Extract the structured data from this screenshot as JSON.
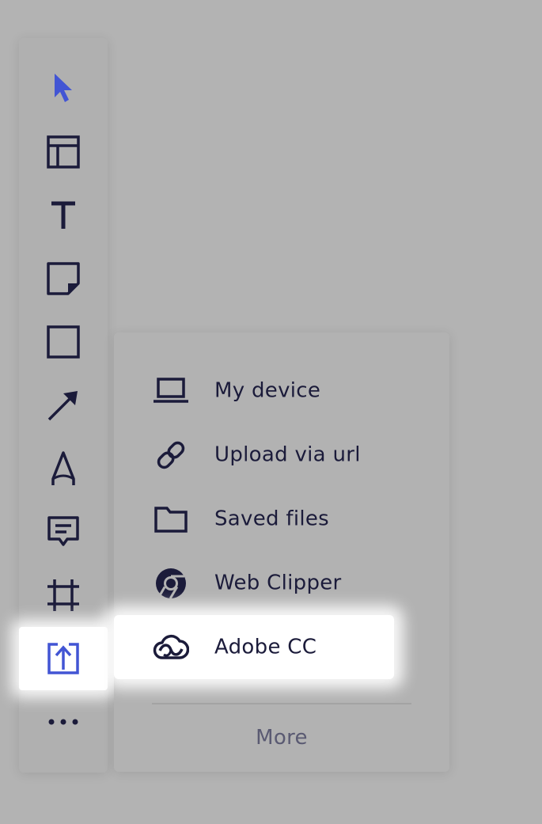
{
  "colors": {
    "ink": "#1b1b3a",
    "accent": "#4255d4",
    "backdrop": "#b3b3b3",
    "highlight": "#ffffff"
  },
  "toolbar": {
    "tools": [
      {
        "name": "select",
        "icon": "cursor-arrow-icon",
        "active": true
      },
      {
        "name": "templates",
        "icon": "layout-template-icon"
      },
      {
        "name": "text",
        "icon": "text-t-icon"
      },
      {
        "name": "sticky-note",
        "icon": "sticky-note-icon"
      },
      {
        "name": "shapes",
        "icon": "square-shape-icon"
      },
      {
        "name": "line",
        "icon": "arrow-line-icon"
      },
      {
        "name": "pen",
        "icon": "pen-draw-icon"
      },
      {
        "name": "comment",
        "icon": "comment-icon"
      },
      {
        "name": "frame",
        "icon": "frame-icon"
      },
      {
        "name": "upload",
        "icon": "upload-icon",
        "active": true
      },
      {
        "name": "more",
        "icon": "more-dots-icon"
      }
    ]
  },
  "upload_menu": {
    "items": [
      {
        "label": "My device",
        "icon": "laptop-icon"
      },
      {
        "label": "Upload via url",
        "icon": "link-icon"
      },
      {
        "label": "Saved files",
        "icon": "folder-icon"
      },
      {
        "label": "Web Clipper",
        "icon": "chrome-icon"
      },
      {
        "label": "Adobe CC",
        "icon": "adobe-cc-icon"
      }
    ],
    "more_label": "More"
  }
}
